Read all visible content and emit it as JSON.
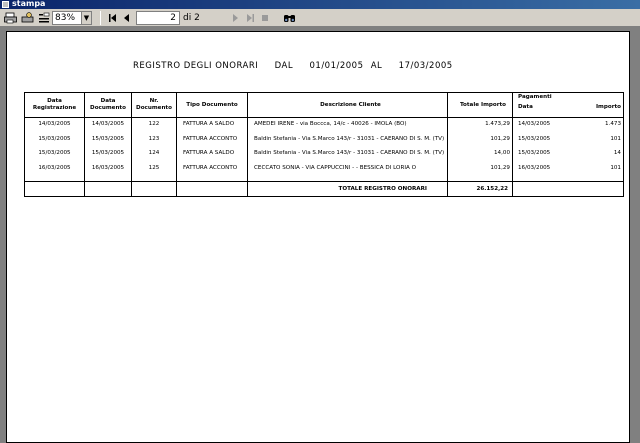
{
  "window": {
    "title": "stampa"
  },
  "toolbar": {
    "zoom_value": "83%",
    "page_current": "2",
    "page_of": "di 2",
    "icons": [
      "print-icon",
      "setup-icon",
      "fit-page-icon",
      "first-page-icon",
      "prev-page-icon",
      "next-page-icon",
      "last-page-icon",
      "stop-icon",
      "find-icon"
    ]
  },
  "report": {
    "title": "REGISTRO  DEGLI  ONORARI",
    "dal_label": "DAL",
    "date_from": "01/01/2005",
    "al_label": "AL",
    "date_to": "17/03/2005",
    "headers": {
      "data_reg_1": "Data",
      "data_reg_2": "Registrazione",
      "data_doc_1": "Data",
      "data_doc_2": "Documento",
      "nr_doc_1": "Nr.",
      "nr_doc_2": "Documento",
      "tipo_doc": "Tipo Documento",
      "descr": "Descrizione Cliente",
      "tot_importo": "Totale Importo",
      "pagamenti": "Pagamenti",
      "pag_data": "Data",
      "pag_importo": "Importo"
    },
    "rows": [
      {
        "data_reg": "14/03/2005",
        "data_doc": "14/03/2005",
        "nr": "122",
        "tipo": "FATTURA A SALDO",
        "descr": "AMEDEI IRENE - via Boccca, 14/c - 40026 - IMOLA (BO)",
        "importo": "1.473,29",
        "pag_data": "14/03/2005",
        "pag_importo": "1.473"
      },
      {
        "data_reg": "15/03/2005",
        "data_doc": "15/03/2005",
        "nr": "123",
        "tipo": "FATTURA ACCONTO",
        "descr": "Baldin Stefania - Via S.Marco 143/r - 31031 - CAERANO DI S. M. (TV)",
        "importo": "101,29",
        "pag_data": "15/03/2005",
        "pag_importo": "101"
      },
      {
        "data_reg": "15/03/2005",
        "data_doc": "15/03/2005",
        "nr": "124",
        "tipo": "FATTURA A SALDO",
        "descr": "Baldin Stefania - Via S.Marco 143/r - 31031 - CAERANO DI S. M. (TV)",
        "importo": "14,00",
        "pag_data": "15/03/2005",
        "pag_importo": "14"
      },
      {
        "data_reg": "16/03/2005",
        "data_doc": "16/03/2005",
        "nr": "125",
        "tipo": "FATTURA ACCONTO",
        "descr": "CECCATO SONIA - VIA CAPPUCCINI - - BESSICA DI LORIA O",
        "importo": "101,29",
        "pag_data": "16/03/2005",
        "pag_importo": "101"
      }
    ],
    "total_label": "TOTALE REGISTRO ONORARI",
    "total_value": "26.152,22"
  }
}
